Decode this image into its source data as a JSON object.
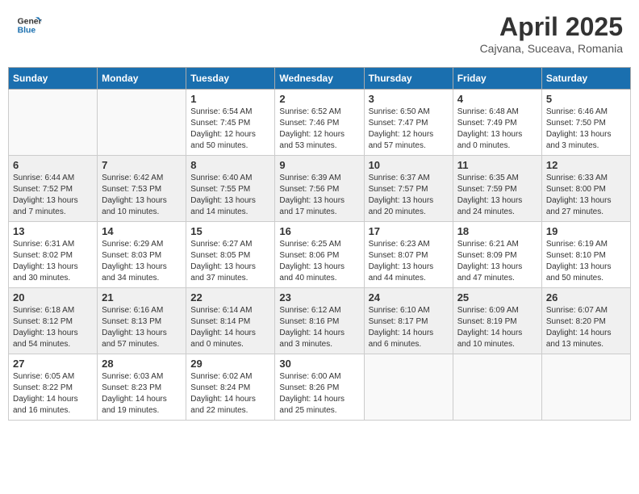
{
  "header": {
    "logo_line1": "General",
    "logo_line2": "Blue",
    "month": "April 2025",
    "location": "Cajvana, Suceava, Romania"
  },
  "weekdays": [
    "Sunday",
    "Monday",
    "Tuesday",
    "Wednesday",
    "Thursday",
    "Friday",
    "Saturday"
  ],
  "weeks": [
    [
      {
        "day": "",
        "info": ""
      },
      {
        "day": "",
        "info": ""
      },
      {
        "day": "1",
        "info": "Sunrise: 6:54 AM\nSunset: 7:45 PM\nDaylight: 12 hours\nand 50 minutes."
      },
      {
        "day": "2",
        "info": "Sunrise: 6:52 AM\nSunset: 7:46 PM\nDaylight: 12 hours\nand 53 minutes."
      },
      {
        "day": "3",
        "info": "Sunrise: 6:50 AM\nSunset: 7:47 PM\nDaylight: 12 hours\nand 57 minutes."
      },
      {
        "day": "4",
        "info": "Sunrise: 6:48 AM\nSunset: 7:49 PM\nDaylight: 13 hours\nand 0 minutes."
      },
      {
        "day": "5",
        "info": "Sunrise: 6:46 AM\nSunset: 7:50 PM\nDaylight: 13 hours\nand 3 minutes."
      }
    ],
    [
      {
        "day": "6",
        "info": "Sunrise: 6:44 AM\nSunset: 7:52 PM\nDaylight: 13 hours\nand 7 minutes."
      },
      {
        "day": "7",
        "info": "Sunrise: 6:42 AM\nSunset: 7:53 PM\nDaylight: 13 hours\nand 10 minutes."
      },
      {
        "day": "8",
        "info": "Sunrise: 6:40 AM\nSunset: 7:55 PM\nDaylight: 13 hours\nand 14 minutes."
      },
      {
        "day": "9",
        "info": "Sunrise: 6:39 AM\nSunset: 7:56 PM\nDaylight: 13 hours\nand 17 minutes."
      },
      {
        "day": "10",
        "info": "Sunrise: 6:37 AM\nSunset: 7:57 PM\nDaylight: 13 hours\nand 20 minutes."
      },
      {
        "day": "11",
        "info": "Sunrise: 6:35 AM\nSunset: 7:59 PM\nDaylight: 13 hours\nand 24 minutes."
      },
      {
        "day": "12",
        "info": "Sunrise: 6:33 AM\nSunset: 8:00 PM\nDaylight: 13 hours\nand 27 minutes."
      }
    ],
    [
      {
        "day": "13",
        "info": "Sunrise: 6:31 AM\nSunset: 8:02 PM\nDaylight: 13 hours\nand 30 minutes."
      },
      {
        "day": "14",
        "info": "Sunrise: 6:29 AM\nSunset: 8:03 PM\nDaylight: 13 hours\nand 34 minutes."
      },
      {
        "day": "15",
        "info": "Sunrise: 6:27 AM\nSunset: 8:05 PM\nDaylight: 13 hours\nand 37 minutes."
      },
      {
        "day": "16",
        "info": "Sunrise: 6:25 AM\nSunset: 8:06 PM\nDaylight: 13 hours\nand 40 minutes."
      },
      {
        "day": "17",
        "info": "Sunrise: 6:23 AM\nSunset: 8:07 PM\nDaylight: 13 hours\nand 44 minutes."
      },
      {
        "day": "18",
        "info": "Sunrise: 6:21 AM\nSunset: 8:09 PM\nDaylight: 13 hours\nand 47 minutes."
      },
      {
        "day": "19",
        "info": "Sunrise: 6:19 AM\nSunset: 8:10 PM\nDaylight: 13 hours\nand 50 minutes."
      }
    ],
    [
      {
        "day": "20",
        "info": "Sunrise: 6:18 AM\nSunset: 8:12 PM\nDaylight: 13 hours\nand 54 minutes."
      },
      {
        "day": "21",
        "info": "Sunrise: 6:16 AM\nSunset: 8:13 PM\nDaylight: 13 hours\nand 57 minutes."
      },
      {
        "day": "22",
        "info": "Sunrise: 6:14 AM\nSunset: 8:14 PM\nDaylight: 14 hours\nand 0 minutes."
      },
      {
        "day": "23",
        "info": "Sunrise: 6:12 AM\nSunset: 8:16 PM\nDaylight: 14 hours\nand 3 minutes."
      },
      {
        "day": "24",
        "info": "Sunrise: 6:10 AM\nSunset: 8:17 PM\nDaylight: 14 hours\nand 6 minutes."
      },
      {
        "day": "25",
        "info": "Sunrise: 6:09 AM\nSunset: 8:19 PM\nDaylight: 14 hours\nand 10 minutes."
      },
      {
        "day": "26",
        "info": "Sunrise: 6:07 AM\nSunset: 8:20 PM\nDaylight: 14 hours\nand 13 minutes."
      }
    ],
    [
      {
        "day": "27",
        "info": "Sunrise: 6:05 AM\nSunset: 8:22 PM\nDaylight: 14 hours\nand 16 minutes."
      },
      {
        "day": "28",
        "info": "Sunrise: 6:03 AM\nSunset: 8:23 PM\nDaylight: 14 hours\nand 19 minutes."
      },
      {
        "day": "29",
        "info": "Sunrise: 6:02 AM\nSunset: 8:24 PM\nDaylight: 14 hours\nand 22 minutes."
      },
      {
        "day": "30",
        "info": "Sunrise: 6:00 AM\nSunset: 8:26 PM\nDaylight: 14 hours\nand 25 minutes."
      },
      {
        "day": "",
        "info": ""
      },
      {
        "day": "",
        "info": ""
      },
      {
        "day": "",
        "info": ""
      }
    ]
  ]
}
